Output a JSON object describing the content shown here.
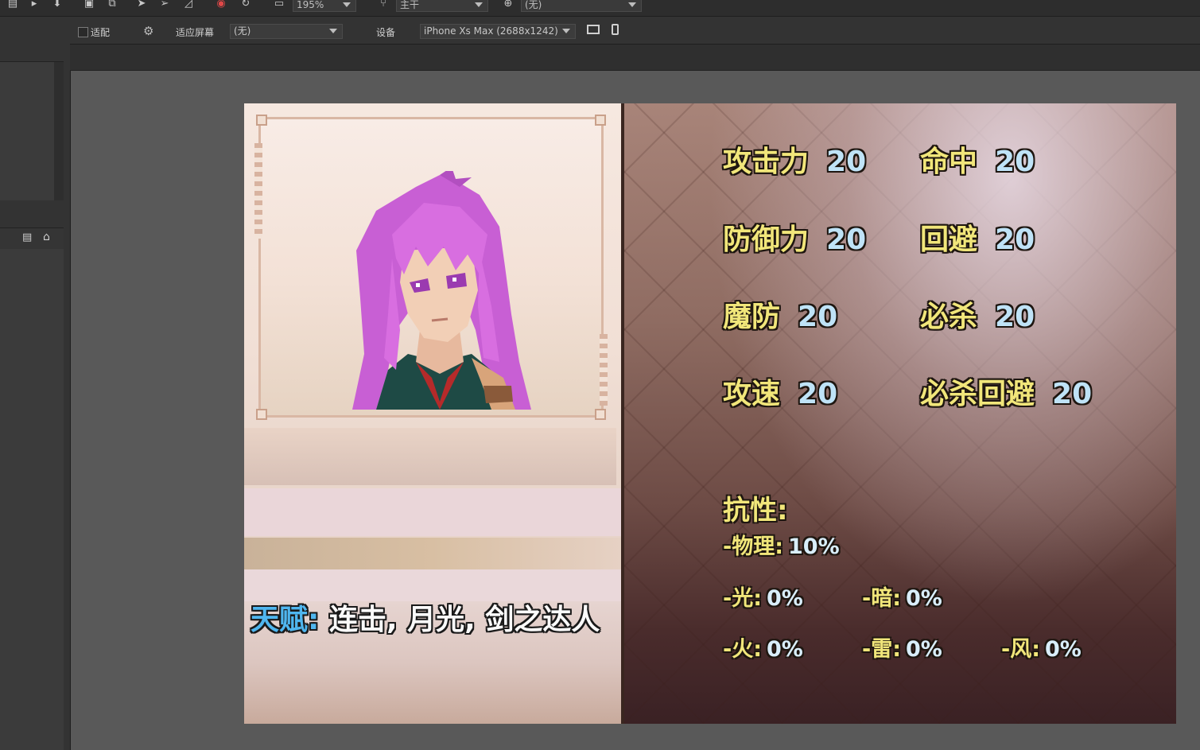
{
  "toolbar": {
    "zoom": "195%",
    "branch": "主干",
    "language": "(无)"
  },
  "toolbar2": {
    "fit_label": "适配",
    "fit_screen_label": "适应屏幕",
    "fit_screen_value": "(无)",
    "device_label": "设备",
    "device_value": "iPhone Xs Max (2688x1242)"
  },
  "game": {
    "talent_label": "天赋:",
    "talent_value": "连击, 月光, 剑之达人",
    "stats": [
      {
        "label": "攻击力",
        "value": "20"
      },
      {
        "label": "命中",
        "value": "20"
      },
      {
        "label": "防御力",
        "value": "20"
      },
      {
        "label": "回避",
        "value": "20"
      },
      {
        "label": "魔防",
        "value": "20"
      },
      {
        "label": "必杀",
        "value": "20"
      },
      {
        "label": "攻速",
        "value": "20"
      },
      {
        "label": "必杀回避",
        "value": "20"
      }
    ],
    "resist_title": "抗性:",
    "resists": [
      {
        "label": "-物理:",
        "value": "10%"
      },
      {
        "label": "-光:",
        "value": "0%"
      },
      {
        "label": "-暗:",
        "value": "0%"
      },
      {
        "label": "-火:",
        "value": "0%"
      },
      {
        "label": "-雷:",
        "value": "0%"
      },
      {
        "label": "-风:",
        "value": "0%"
      }
    ]
  },
  "colors": {
    "stat_label": "#f1e67a",
    "stat_value": "#bfe3f7",
    "talent_label": "#4fb6ef",
    "hair": "#d86ee0"
  }
}
